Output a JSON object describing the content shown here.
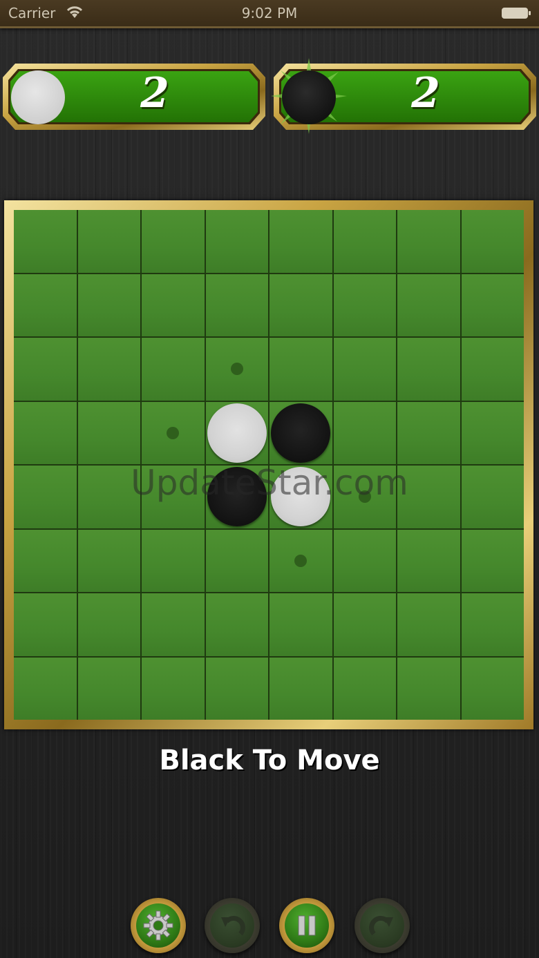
{
  "status_bar": {
    "carrier": "Carrier",
    "time": "9:02 PM"
  },
  "scores": {
    "white": {
      "value": "2",
      "disc": "white"
    },
    "black": {
      "value": "2",
      "disc": "black"
    }
  },
  "board": {
    "size": 8,
    "pieces": [
      {
        "row": 3,
        "col": 3,
        "color": "white"
      },
      {
        "row": 3,
        "col": 4,
        "color": "black"
      },
      {
        "row": 4,
        "col": 3,
        "color": "black"
      },
      {
        "row": 4,
        "col": 4,
        "color": "white"
      }
    ],
    "hints": [
      {
        "row": 2,
        "col": 3
      },
      {
        "row": 3,
        "col": 2
      },
      {
        "row": 4,
        "col": 5
      },
      {
        "row": 5,
        "col": 4
      }
    ]
  },
  "watermark": "UpdateStar.com",
  "turn_text": "Black To Move",
  "toolbar": {
    "buttons": [
      {
        "name": "settings-button",
        "icon": "gear-icon",
        "enabled": true
      },
      {
        "name": "undo-button",
        "icon": "undo-icon",
        "enabled": false
      },
      {
        "name": "pause-button",
        "icon": "pause-icon",
        "enabled": true
      },
      {
        "name": "redo-button",
        "icon": "redo-icon",
        "enabled": false
      }
    ]
  },
  "colors": {
    "panel_green": "#2d8a0a",
    "board_green": "#45882c",
    "gold": "#c9a443"
  }
}
